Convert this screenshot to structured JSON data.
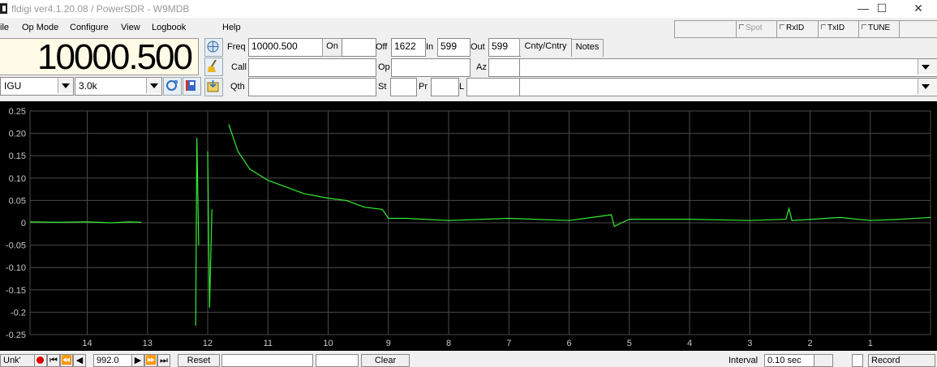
{
  "window": {
    "title": "fldigi ver4.1.20.08 / PowerSDR - W9MDB",
    "minimize": "—",
    "maximize": "☐",
    "close": "✕"
  },
  "menu": {
    "file": "ile",
    "op_mode": "Op Mode",
    "configure": "Configure",
    "view": "View",
    "logbook": "Logbook",
    "help": "Help"
  },
  "top_buttons": {
    "spot": "Spot",
    "rxid": "RxID",
    "txid": "TxID",
    "tune": "TUNE"
  },
  "rig": {
    "frequency": "10000.500",
    "mode": "IGU",
    "bandwidth": "3.0k"
  },
  "log": {
    "freq_label": "Freq",
    "freq_value": "10000.500",
    "on_label": "On",
    "on_value": "",
    "off_label": "Off",
    "off_value": "1622",
    "in_label": "In",
    "in_value": "599",
    "out_label": "Out",
    "out_value": "599",
    "cnty_tab": "Cnty/Cntry",
    "notes_tab": "Notes",
    "call_label": "Call",
    "call_value": "",
    "op_label": "Op",
    "op_value": "",
    "az_label": "Az",
    "az_value": "",
    "qth_label": "Qth",
    "qth_value": "",
    "st_label": "St",
    "st_value": "",
    "pr_label": "Pr",
    "pr_value": "",
    "l_label": "L",
    "l_value": ""
  },
  "bottom": {
    "unk": "Unk'",
    "value": "992.0",
    "reset": "Reset",
    "clear": "Clear",
    "interval_label": "Interval",
    "interval_value": "0.10 sec",
    "record": "Record"
  },
  "chart_data": {
    "type": "line",
    "title": "",
    "xlabel": "",
    "ylabel": "",
    "xlim": [
      14.95,
      0.0
    ],
    "ylim": [
      -0.25,
      0.25
    ],
    "x_ticks": [
      14,
      13,
      12,
      11,
      10,
      9,
      8,
      7,
      6,
      5,
      4,
      3,
      2,
      1
    ],
    "y_ticks": [
      "0.25",
      "0.20",
      "0.15",
      "0.10",
      "0.05",
      "0",
      "-0.05",
      "-0.10",
      "-0.15",
      "-0.2",
      "-0.25"
    ],
    "grid": true,
    "colors": {
      "background": "#000000",
      "grid": "#4a4a4a",
      "line": "#33ee33",
      "text": "#c8c8c8"
    },
    "series": [
      {
        "segments": [
          [
            [
              14.95,
              0.002
            ],
            [
              14.5,
              0.001
            ],
            [
              14.0,
              0.002
            ],
            [
              13.6,
              0.0
            ],
            [
              13.3,
              0.002
            ],
            [
              13.1,
              0.001
            ]
          ],
          [
            [
              12.2,
              -0.23
            ],
            [
              12.18,
              0.19
            ],
            [
              12.15,
              -0.05
            ]
          ],
          [
            [
              12.0,
              0.16
            ],
            [
              11.97,
              -0.19
            ],
            [
              11.93,
              0.03
            ]
          ],
          [
            [
              11.65,
              0.22
            ],
            [
              11.5,
              0.16
            ],
            [
              11.3,
              0.12
            ],
            [
              11.0,
              0.095
            ],
            [
              10.7,
              0.08
            ],
            [
              10.4,
              0.065
            ],
            [
              10.0,
              0.055
            ],
            [
              9.7,
              0.05
            ],
            [
              9.4,
              0.035
            ],
            [
              9.1,
              0.03
            ],
            [
              9.0,
              0.01
            ],
            [
              8.7,
              0.01
            ],
            [
              8.0,
              0.005
            ],
            [
              7.0,
              0.01
            ],
            [
              6.0,
              0.005
            ],
            [
              5.3,
              0.018
            ],
            [
              5.25,
              -0.008
            ],
            [
              5.0,
              0.008
            ],
            [
              4.0,
              0.008
            ],
            [
              3.0,
              0.005
            ],
            [
              2.4,
              0.008
            ],
            [
              2.35,
              0.032
            ],
            [
              2.3,
              0.005
            ],
            [
              1.5,
              0.012
            ],
            [
              1.0,
              0.005
            ],
            [
              0.5,
              0.008
            ],
            [
              0.0,
              0.012
            ]
          ]
        ]
      }
    ]
  }
}
